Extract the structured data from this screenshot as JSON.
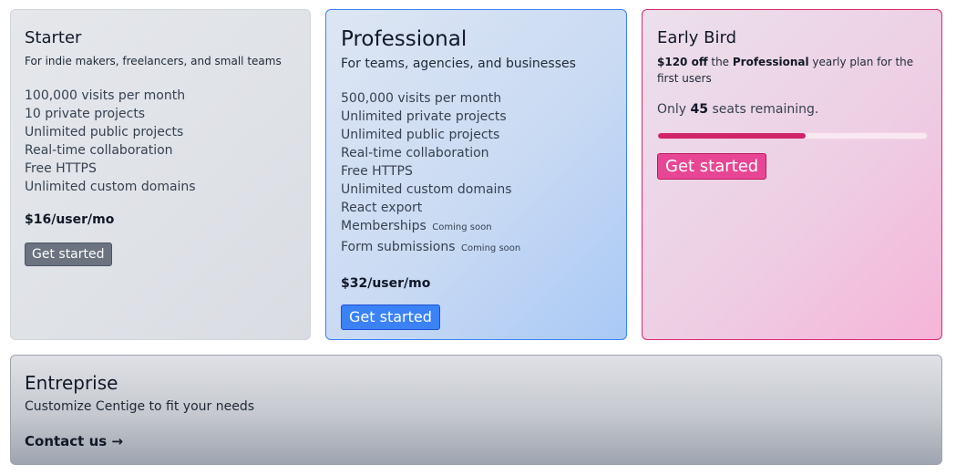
{
  "starter": {
    "title": "Starter",
    "subtitle": "For indie makers, freelancers, and small teams",
    "features": [
      "100,000 visits per month",
      "10 private projects",
      "Unlimited public projects",
      "Real-time collaboration",
      "Free HTTPS",
      "Unlimited custom domains"
    ],
    "price": "$16/user/mo",
    "button_label": "Get started"
  },
  "professional": {
    "title": "Professional",
    "subtitle": "For teams, agencies, and businesses",
    "features": [
      {
        "label": "500,000 visits per month"
      },
      {
        "label": "Unlimited private projects"
      },
      {
        "label": "Unlimited public projects"
      },
      {
        "label": "Real-time collaboration"
      },
      {
        "label": "Free HTTPS"
      },
      {
        "label": "Unlimited custom domains"
      },
      {
        "label": "React export"
      },
      {
        "label": "Memberships",
        "badge": "Coming soon"
      },
      {
        "label": "Form submissions",
        "badge": "Coming soon"
      }
    ],
    "price": "$32/user/mo",
    "button_label": "Get started"
  },
  "early_bird": {
    "title": "Early Bird",
    "discount": "$120 off",
    "desc_mid": " the ",
    "plan_name": "Professional",
    "desc_end": " yearly plan for the first users",
    "seats_prefix": "Only ",
    "seats_count": "45",
    "seats_suffix": " seats remaining.",
    "progress_fraction": 0.55,
    "button_label": "Get started"
  },
  "enterprise": {
    "title": "Entreprise",
    "subtitle": "Customize Centige to fit your needs",
    "link_label": "Contact us →"
  },
  "colors": {
    "blue_accent": "#3b82f6",
    "pink_accent": "#db2777",
    "gray_button": "#6b7280"
  }
}
